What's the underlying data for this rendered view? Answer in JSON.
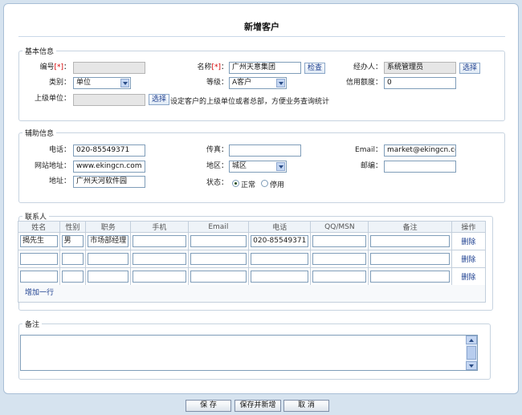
{
  "title": "新增客户",
  "basic": {
    "legend": "基本信息",
    "code_label": "编号",
    "req_mark": "[*]",
    "colon": "：",
    "name_label": "名称",
    "name_value": "广州天意集团",
    "check_button": "检查",
    "manager_label": "经办人：",
    "manager_value": "系统管理员",
    "choose_button": "选择",
    "type_label": "类别：",
    "type_value": "单位",
    "level_label": "等级：",
    "level_value": "A客户",
    "credit_label": "信用额度：",
    "credit_value": "0",
    "parent_label": "上级单位：",
    "parent_choose_button": "选择",
    "parent_hint": "设定客户的上级单位或者总部，方便业务查询统计"
  },
  "aux": {
    "legend": "辅助信息",
    "phone_label": "电话：",
    "phone_value": "020-85549371",
    "fax_label": "传真：",
    "fax_value": "",
    "email_label": "Email：",
    "email_value": "market@ekingcn.com",
    "site_label": "网站地址：",
    "site_value": "www.ekingcn.com",
    "region_label": "地区：",
    "region_value": "城区",
    "zip_label": "邮编：",
    "zip_value": "",
    "addr_label": "地址：",
    "addr_value": "广州天河软件园",
    "status_label": "状态：",
    "status_normal": "正常",
    "status_disabled": "停用"
  },
  "contacts": {
    "legend": "联系人",
    "headers": [
      "姓名",
      "性别",
      "职务",
      "手机",
      "Email",
      "电话",
      "QQ/MSN",
      "备注",
      "操作"
    ],
    "rows": [
      [
        "揭先生",
        "男",
        "市场部经理",
        "",
        "",
        "020-85549371",
        "",
        ""
      ],
      [
        "",
        "",
        "",
        "",
        "",
        "",
        "",
        ""
      ],
      [
        "",
        "",
        "",
        "",
        "",
        "",
        "",
        ""
      ]
    ],
    "delete_label": "删除",
    "add_row": "增加一行"
  },
  "remark": {
    "legend": "备注",
    "value": ""
  },
  "buttons": {
    "save": "保 存",
    "save_new": "保存并新增",
    "cancel": "取 消"
  }
}
